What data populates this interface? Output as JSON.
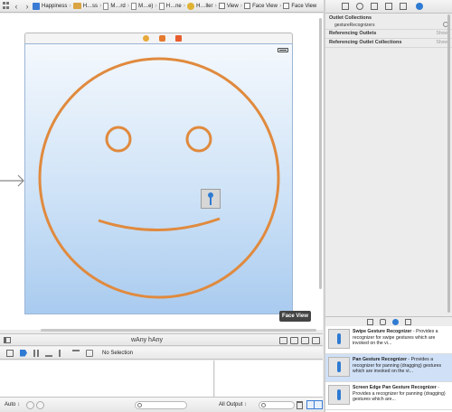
{
  "jumpbar": {
    "crumbs": [
      "Happiness",
      "H…ss",
      "M…rd",
      "M…e)",
      "H…ne",
      "H…ller",
      "View",
      "Face View",
      "Face View"
    ]
  },
  "canvas": {
    "tooltip": "Face View",
    "size_class": "wAny hAny",
    "colors": {
      "face_stroke": "#e08a3e",
      "view_top": "#f4f8fd",
      "view_bottom": "#a9cbef"
    }
  },
  "debug": {
    "selection": "No Selection"
  },
  "console": {
    "scope": "Auto",
    "output": "All Output"
  },
  "inspector": {
    "outlet_collections": "Outlet Collections",
    "outlet_item": "gestureRecognizers",
    "referencing_outlets": "Referencing Outlets",
    "referencing_collections": "Referencing Outlet Collections",
    "show": "Show"
  },
  "library": {
    "items": [
      {
        "title": "Swipe Gesture Recognizer",
        "desc": " - Provides a recognizer for swipe gestures which are invoked on the vi..."
      },
      {
        "title": "Pan Gesture Recognizer",
        "desc": " - Provides a recognizer for panning (dragging) gestures which are invoked on the vi..."
      },
      {
        "title": "Screen Edge Pan Gesture Recognizer",
        "desc": " - Provides a recognizer for panning (dragging) gestures which are..."
      }
    ]
  }
}
